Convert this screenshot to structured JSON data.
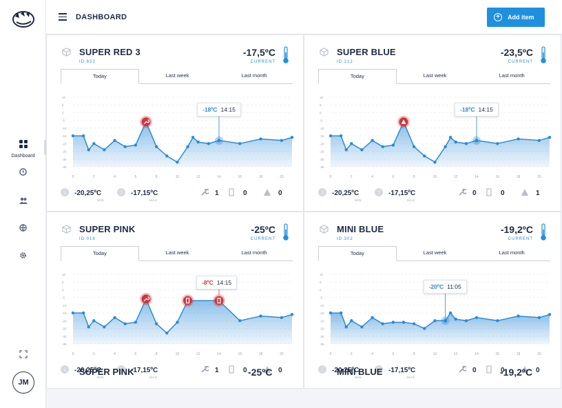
{
  "app": {
    "page_title": "DASHBOARD",
    "add_button_label": "Add item",
    "user_initials": "JM",
    "brand_color": "#1e90e0",
    "alert_color": "#d0343d"
  },
  "sidebar": {
    "items": [
      {
        "name": "dashboard",
        "label": "Dashboard",
        "icon": "grid-icon"
      },
      {
        "name": "history",
        "label": "",
        "icon": "history-icon"
      },
      {
        "name": "users",
        "label": "",
        "icon": "users-icon"
      },
      {
        "name": "globe",
        "label": "",
        "icon": "globe-icon"
      },
      {
        "name": "settings",
        "label": "",
        "icon": "gear-icon"
      }
    ],
    "expand_icon": "expand-icon"
  },
  "tabs": [
    "Today",
    "Last week",
    "Last month"
  ],
  "cards": [
    {
      "name": "SUPER RED 3",
      "id": "ID:652",
      "temperature": "-17,5ºC",
      "current_label": "CURRENT",
      "min_value": "-20,25ºC",
      "min_label": "MIN",
      "max_value": "-17,15ºC",
      "max_label": "MAX",
      "wrench_count": "1",
      "door_count": "0",
      "alert_count": "0",
      "tooltip_value": "-18ºC",
      "tooltip_time": "14:15",
      "tooltip_color": "blue",
      "chart_data": {
        "type": "area",
        "x_ticks": [
          "0",
          "2",
          "4",
          "6",
          "8",
          "10",
          "12",
          "14",
          "16",
          "18",
          "20"
        ],
        "y_ticks": [
          "10",
          "5",
          "0",
          "-5",
          "-10",
          "-15",
          "-20",
          "-25",
          "-30",
          "-35"
        ],
        "ylim": [
          -35,
          10
        ],
        "xlim": [
          0,
          21
        ],
        "x": [
          0,
          1,
          1.5,
          2,
          3,
          4,
          5,
          6,
          7,
          8,
          9,
          10,
          11,
          11.5,
          12,
          13,
          14,
          16,
          18,
          20,
          21
        ],
        "y": [
          -15,
          -15,
          -24,
          -20,
          -24,
          -18,
          -22,
          -21,
          -6,
          -22,
          -28,
          -32,
          -22,
          -16,
          -19,
          -20,
          -18,
          -20,
          -17,
          -18,
          -16
        ],
        "markers": [
          {
            "x": 7,
            "y": -6,
            "type": "wrench"
          }
        ],
        "highlight": {
          "x": 14,
          "y": -18
        }
      }
    },
    {
      "name": "SUPER BLUE",
      "id": "ID:212",
      "temperature": "-23,5ºC",
      "current_label": "CURRENT",
      "min_value": "-20,25ºC",
      "min_label": "MIN",
      "max_value": "-17,15ºC",
      "max_label": "MAX",
      "wrench_count": "0",
      "door_count": "0",
      "alert_count": "1",
      "tooltip_value": "-18ºC",
      "tooltip_time": "14:15",
      "tooltip_color": "blue",
      "chart_data": {
        "type": "area",
        "x_ticks": [
          "0",
          "2",
          "4",
          "6",
          "8",
          "10",
          "12",
          "14",
          "16",
          "18",
          "20"
        ],
        "y_ticks": [
          "10",
          "5",
          "0",
          "-5",
          "-10",
          "-15",
          "-20",
          "-25",
          "-30",
          "-35"
        ],
        "ylim": [
          -35,
          10
        ],
        "xlim": [
          0,
          21
        ],
        "x": [
          0,
          1,
          1.5,
          2,
          3,
          4,
          5,
          6,
          7,
          8,
          9,
          10,
          11,
          11.5,
          12,
          13,
          14,
          16,
          18,
          20,
          21
        ],
        "y": [
          -15,
          -15,
          -24,
          -20,
          -24,
          -18,
          -22,
          -21,
          -6,
          -22,
          -28,
          -32,
          -22,
          -16,
          -19,
          -20,
          -18,
          -20,
          -17,
          -18,
          -16
        ],
        "markers": [
          {
            "x": 7,
            "y": -6,
            "type": "alert"
          }
        ],
        "highlight": {
          "x": 14,
          "y": -18
        }
      }
    },
    {
      "name": "SUPER PINK",
      "id": "ID:018",
      "temperature": "-25ºC",
      "current_label": "CURRENT",
      "min_value": "-20,25ºC",
      "min_label": "MIN",
      "max_value": "-17,15ºC",
      "max_label": "MAX",
      "wrench_count": "1",
      "door_count": "0",
      "alert_count": "0",
      "tooltip_value": "-8ºC",
      "tooltip_time": "14:15",
      "tooltip_color": "red",
      "chart_data": {
        "type": "area",
        "x_ticks": [
          "0",
          "2",
          "4",
          "6",
          "8",
          "10",
          "12",
          "14",
          "16",
          "18",
          "20"
        ],
        "y_ticks": [
          "10",
          "5",
          "0",
          "-5",
          "-10",
          "-15",
          "-20",
          "-25",
          "-30",
          "-35"
        ],
        "ylim": [
          -35,
          10
        ],
        "xlim": [
          0,
          21
        ],
        "x": [
          0,
          1,
          1.5,
          2,
          3,
          4,
          5,
          6,
          7,
          8,
          9,
          10,
          11,
          14,
          16,
          18,
          20,
          21
        ],
        "y": [
          -15,
          -15,
          -24,
          -20,
          -24,
          -18,
          -22,
          -21,
          -6,
          -22,
          -28,
          -21,
          -7,
          -7,
          -20,
          -17,
          -18,
          -16
        ],
        "markers": [
          {
            "x": 7,
            "y": -6,
            "type": "wrench"
          },
          {
            "x": 11,
            "y": -7,
            "type": "door"
          },
          {
            "x": 14,
            "y": -7,
            "type": "door"
          }
        ],
        "highlight": null
      }
    },
    {
      "name": "MINI BLUE",
      "id": "ID:302",
      "temperature": "-19,2ºC",
      "current_label": "CURRENT",
      "min_value": "-20,25ºC",
      "min_label": "MIN",
      "max_value": "-17,15ºC",
      "max_label": "MAX",
      "wrench_count": "0",
      "door_count": "0",
      "alert_count": "0",
      "tooltip_value": "-20ºC",
      "tooltip_time": "11:05",
      "tooltip_color": "blue",
      "chart_data": {
        "type": "area",
        "x_ticks": [
          "0",
          "2",
          "4",
          "6",
          "8",
          "10",
          "12",
          "14",
          "16",
          "18",
          "20"
        ],
        "y_ticks": [
          "10",
          "5",
          "0",
          "-5",
          "-10",
          "-15",
          "-20",
          "-25",
          "-30",
          "-35"
        ],
        "ylim": [
          -35,
          10
        ],
        "xlim": [
          0,
          21
        ],
        "x": [
          0,
          1,
          1.5,
          2,
          3,
          4,
          5,
          6,
          7,
          8,
          9,
          10,
          11,
          11.5,
          12,
          13,
          14,
          16,
          18,
          20,
          21
        ],
        "y": [
          -15,
          -15,
          -24,
          -20,
          -24,
          -18,
          -22,
          -21,
          -21,
          -22,
          -25,
          -20,
          -20,
          -15,
          -19,
          -20,
          -18,
          -20,
          -17,
          -18,
          -16
        ],
        "markers": [],
        "highlight": {
          "x": 11,
          "y": -20
        }
      }
    }
  ],
  "partial_cards": [
    {
      "name": "SUPER PINK",
      "temperature": "-25ºC"
    },
    {
      "name": "MINI BLUE",
      "temperature": "-19,2ºC"
    }
  ]
}
